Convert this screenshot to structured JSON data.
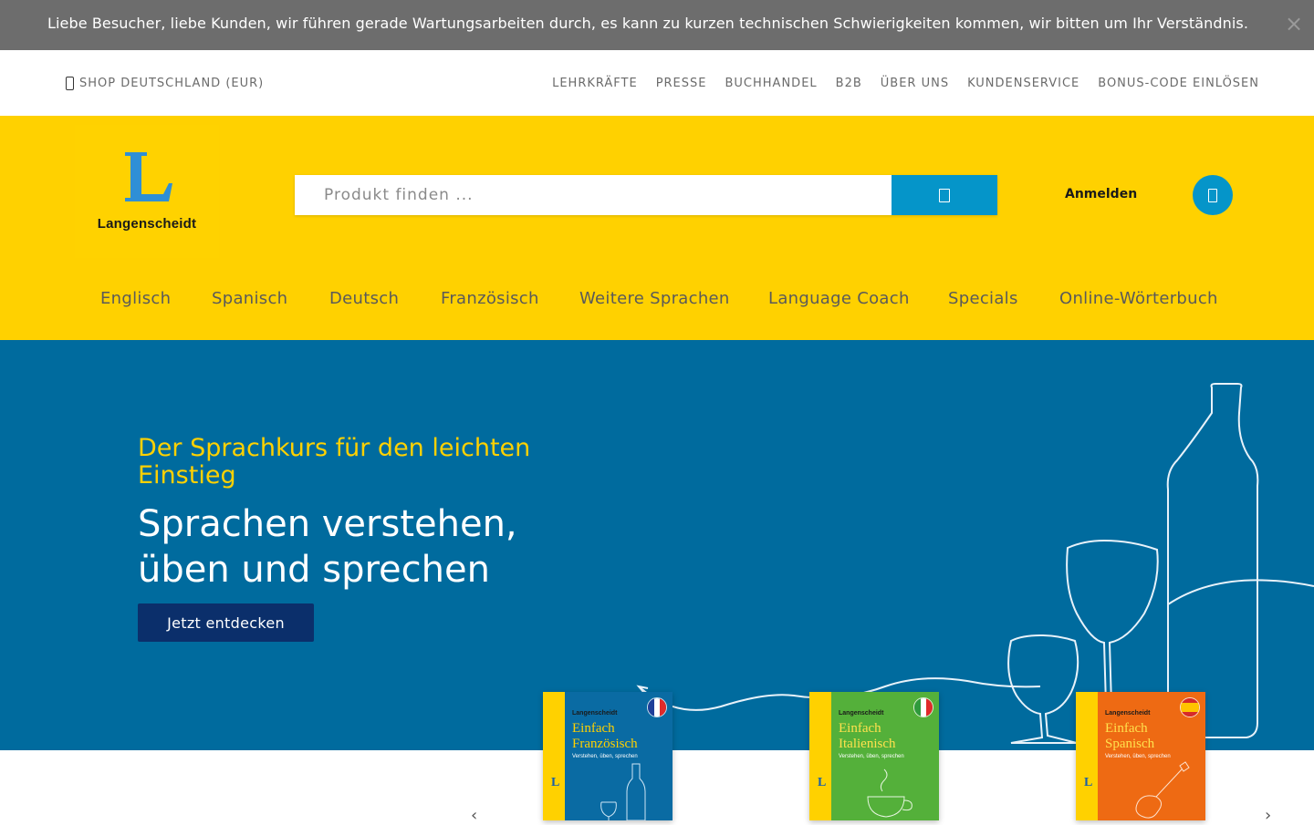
{
  "notice": {
    "text": "Liebe Besucher, liebe Kunden, wir führen gerade Wartungsarbeiten durch, es kann zu kurzen technischen Schwierigkeiten kommen, wir bitten um Ihr Verständnis.",
    "close_label": "×"
  },
  "topbar": {
    "shop_label": "SHOP DEUTSCHLAND (EUR)",
    "links": [
      "LEHRKRÄFTE",
      "PRESSE",
      "BUCHHANDEL",
      "B2B",
      "ÜBER UNS",
      "KUNDENSERVICE",
      "BONUS-CODE EINLÖSEN"
    ]
  },
  "header": {
    "logo_letter": "L",
    "logo_text": "Langenscheidt",
    "search_placeholder": "Produkt finden ...",
    "login_label": "Anmelden"
  },
  "main_nav": {
    "items": [
      "Englisch",
      "Spanisch",
      "Deutsch",
      "Französisch",
      "Weitere Sprachen",
      "Language Coach",
      "Specials",
      "Online-Wörterbuch"
    ]
  },
  "hero": {
    "subtitle": "Der Sprachkurs für den leichten Einstieg",
    "title": "Sprachen verstehen, üben und sprechen",
    "cta_label": "Jetzt entdecken"
  },
  "books": [
    {
      "brand": "Langenscheidt",
      "title_line1": "Einfach",
      "title_line2": "Französisch",
      "tagline": "Verstehen, üben, sprechen",
      "cover_color": "#0a6ba3",
      "text_color": "#ffd100",
      "flag": [
        "#1f3f99",
        "#ffffff",
        "#e02a2a"
      ]
    },
    {
      "brand": "Langenscheidt",
      "title_line1": "Einfach",
      "title_line2": "Italienisch",
      "tagline": "Verstehen, üben, sprechen",
      "cover_color": "#54b03a",
      "text_color": "#ffe14d",
      "flag": [
        "#2f9a3c",
        "#ffffff",
        "#e02a2a"
      ]
    },
    {
      "brand": "Langenscheidt",
      "title_line1": "Einfach",
      "title_line2": "Spanisch",
      "tagline": "Verstehen, üben, sprechen",
      "cover_color": "#ee6a13",
      "text_color": "#ffe14d",
      "flag": [
        "#d62a2a",
        "#ffc400",
        "#d62a2a"
      ]
    }
  ],
  "colors": {
    "brand_yellow": "#ffd100",
    "brand_blue": "#0595c9",
    "hero_blue": "#006b9e",
    "cta_navy": "#0b2f6b"
  },
  "icons": {
    "location": "location-pin-icon",
    "search": "search-icon",
    "cart": "cart-icon",
    "close": "close-icon"
  }
}
